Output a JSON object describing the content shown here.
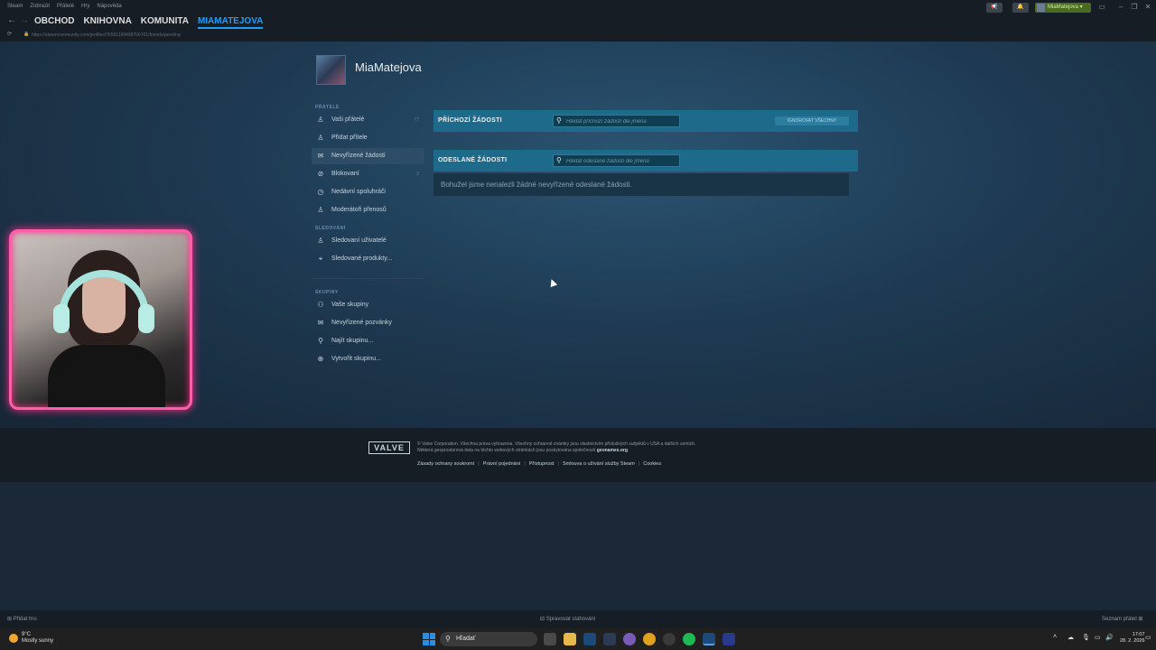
{
  "titlebar": {
    "menu": [
      "Steam",
      "Zobrazit",
      "Přátelé",
      "Hry",
      "Nápověda"
    ],
    "username": "MiaMatejova"
  },
  "nav": {
    "links": [
      "OBCHOD",
      "KNIHOVNA",
      "KOMUNITA",
      "MIAMATEJOVA"
    ],
    "active": "MIAMATEJOVA",
    "url": "https://steamcommunity.com/profiles/76561199498766701/friends/pending"
  },
  "profile": {
    "name": "MiaMatejova"
  },
  "sidebar": {
    "section_friends": "PŘÁTELÉ",
    "friends_items": [
      {
        "label": "Vaši přátelé",
        "count": "77"
      },
      {
        "label": "Přidat přítele",
        "count": ""
      },
      {
        "label": "Nevyřízené žádosti",
        "count": ""
      },
      {
        "label": "Blokovaní",
        "count": "2"
      },
      {
        "label": "Nedávní spoluhráči",
        "count": ""
      },
      {
        "label": "Moderátoři přenosů",
        "count": ""
      }
    ],
    "section_following": "SLEDOVÁNÍ",
    "following_items": [
      {
        "label": "Sledovaní uživatelé"
      },
      {
        "label": "Sledované produkty..."
      }
    ],
    "section_groups": "SKUPINY",
    "group_items": [
      {
        "label": "Vaše skupiny"
      },
      {
        "label": "Nevyřízené pozvánky"
      },
      {
        "label": "Najít skupinu..."
      },
      {
        "label": "Vytvořit skupinu..."
      }
    ]
  },
  "incoming": {
    "title": "PŘÍCHOZÍ ŽÁDOSTI",
    "search_placeholder": "Hledat příchozí žádosti dle jména",
    "ignore_all": "IGNOROVAT VŠECHNY"
  },
  "outgoing": {
    "title": "ODESLANÉ ŽÁDOSTI",
    "search_placeholder": "Hledat odeslané žádosti dle jména",
    "empty_message": "Bohužel jsme nenalezli žádné nevyřízené odeslané žádosti."
  },
  "footer": {
    "logo": "VALVE",
    "line1": "© Valve Corporation. Všechna práva vyhrazena. Všechny ochranné známky jsou vlastnictvím příslušných subjektů v USA a dalších zemích.",
    "line2": "Některá geoprostorová data na těchto webových stránkách jsou poskytována společností",
    "line2_link": "geonames.org",
    "links": [
      "Zásady ochrany soukromí",
      "Právní pojednání",
      "Přístupnost",
      "Smlouva o užívání služby Steam",
      "Cookies"
    ]
  },
  "steambar": {
    "add_game": "Přidat hru",
    "downloads": "Spravovat stahování",
    "friends_list": "Seznam přátel"
  },
  "taskbar": {
    "temp": "9°C",
    "weather": "Mostly sunny",
    "search_label": "Hľadať",
    "time": "17:07",
    "date": "28. 2. 2026"
  },
  "colors": {
    "accent": "#1a9fff",
    "panel_header": "#1d6a8a",
    "webcam_border": "#ff5fa8"
  }
}
